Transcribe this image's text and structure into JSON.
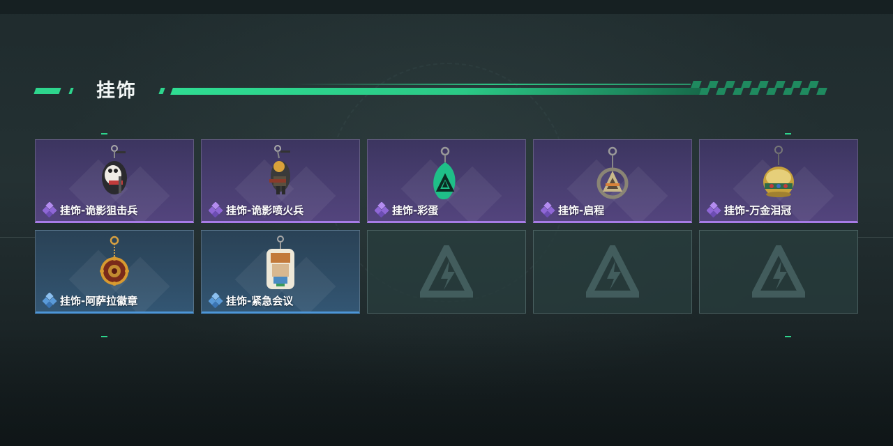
{
  "page": {
    "title": "挂饰"
  },
  "colors": {
    "accent": "#2ed58d",
    "purple_rarity": "#a77be6",
    "blue_rarity": "#4d96d8"
  },
  "items": [
    {
      "label": "挂饰-诡影狙击兵",
      "rarity": "purple",
      "icon": "sniper-figure-charm-icon"
    },
    {
      "label": "挂饰-诡影喷火兵",
      "rarity": "purple",
      "icon": "flamethrower-figure-charm-icon"
    },
    {
      "label": "挂饰-彩蛋",
      "rarity": "purple",
      "icon": "easter-egg-charm-icon"
    },
    {
      "label": "挂饰-启程",
      "rarity": "purple",
      "icon": "departure-ring-charm-icon"
    },
    {
      "label": "挂饰-万金泪冠",
      "rarity": "purple",
      "icon": "golden-crown-charm-icon"
    },
    {
      "label": "挂饰-阿萨拉徽章",
      "rarity": "blue",
      "icon": "asala-badge-charm-icon"
    },
    {
      "label": "挂饰-紧急会议",
      "rarity": "blue",
      "icon": "emergency-meeting-charm-icon"
    },
    {
      "label": "",
      "rarity": "empty",
      "icon": "game-logo-icon"
    },
    {
      "label": "",
      "rarity": "empty",
      "icon": "game-logo-icon"
    },
    {
      "label": "",
      "rarity": "empty",
      "icon": "game-logo-icon"
    }
  ]
}
